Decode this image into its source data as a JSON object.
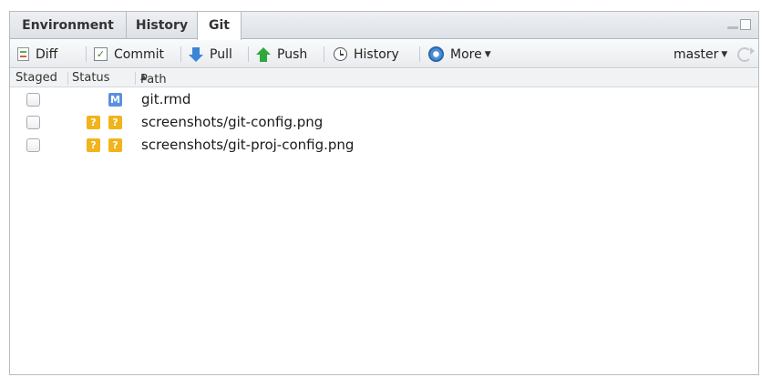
{
  "tabs": [
    {
      "label": "Environment",
      "active": false
    },
    {
      "label": "History",
      "active": false
    },
    {
      "label": "Git",
      "active": true
    }
  ],
  "toolbar": {
    "diff_label": "Diff",
    "commit_label": "Commit",
    "pull_label": "Pull",
    "push_label": "Push",
    "history_label": "History",
    "more_label": "More",
    "branch_label": "master"
  },
  "columns": {
    "staged": "Staged",
    "status": "Status",
    "path": "Path"
  },
  "files": [
    {
      "path": "git.rmd",
      "status": [
        "M"
      ],
      "staged": false
    },
    {
      "path": "screenshots/git-config.png",
      "status": [
        "?",
        "?"
      ],
      "staged": false
    },
    {
      "path": "screenshots/git-proj-config.png",
      "status": [
        "?",
        "?"
      ],
      "staged": false
    }
  ],
  "icons": {
    "diff": "diff-icon",
    "commit": "commit-icon",
    "pull": "pull-arrow-icon",
    "push": "push-arrow-icon",
    "history": "clock-icon",
    "more": "gear-icon",
    "refresh": "refresh-icon"
  },
  "colors": {
    "modified_badge": "#5b8fe0",
    "untracked_badge": "#f2b41c",
    "pull_arrow": "#3b84d8",
    "push_arrow": "#2fa83c"
  }
}
